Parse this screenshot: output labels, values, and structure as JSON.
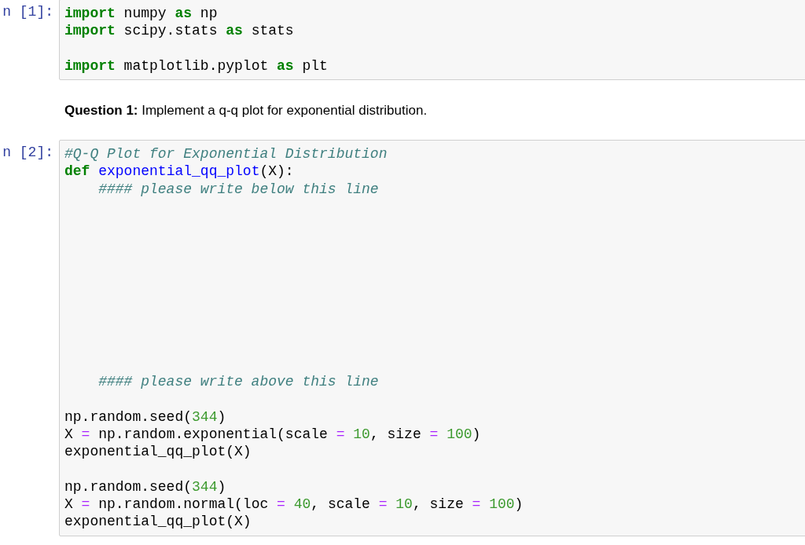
{
  "cells": [
    {
      "kind": "code",
      "prompt": "n [1]:",
      "lines": [
        {
          "kind": "code",
          "indented": false,
          "tokens": [
            {
              "kind": "keyword",
              "text": "import"
            },
            {
              "kind": "plain",
              "text": " numpy "
            },
            {
              "kind": "keyword",
              "text": "as"
            },
            {
              "kind": "plain",
              "text": " np"
            }
          ]
        },
        {
          "kind": "code",
          "indented": false,
          "tokens": [
            {
              "kind": "keyword",
              "text": "import"
            },
            {
              "kind": "plain",
              "text": " scipy.stats "
            },
            {
              "kind": "keyword",
              "text": "as"
            },
            {
              "kind": "plain",
              "text": " stats"
            }
          ]
        },
        {
          "kind": "blank"
        },
        {
          "kind": "code",
          "indented": false,
          "tokens": [
            {
              "kind": "keyword",
              "text": "import"
            },
            {
              "kind": "plain",
              "text": " matplotlib.pyplot "
            },
            {
              "kind": "keyword",
              "text": "as"
            },
            {
              "kind": "plain",
              "text": " plt"
            }
          ]
        }
      ]
    },
    {
      "kind": "markdown",
      "text": "**Question 1:** Implement a q-q plot for exponential distribution."
    },
    {
      "kind": "code",
      "prompt": "n [2]:",
      "lines": [
        {
          "kind": "code",
          "indented": false,
          "tokens": [
            {
              "kind": "comment",
              "text": "#Q-Q Plot for Exponential Distribution"
            }
          ]
        },
        {
          "kind": "code",
          "indented": false,
          "tokens": [
            {
              "kind": "keyword",
              "text": "def "
            },
            {
              "kind": "function",
              "text": "exponential_qq_plot"
            },
            {
              "kind": "plain",
              "text": "(X):"
            }
          ]
        },
        {
          "kind": "code",
          "indented": true,
          "tokens": [
            {
              "kind": "comment",
              "text": "#### please write below this line"
            }
          ]
        },
        {
          "kind": "blank"
        },
        {
          "kind": "blank"
        },
        {
          "kind": "blank"
        },
        {
          "kind": "blank"
        },
        {
          "kind": "blank"
        },
        {
          "kind": "blank"
        },
        {
          "kind": "blank"
        },
        {
          "kind": "blank"
        },
        {
          "kind": "blank"
        },
        {
          "kind": "blank"
        },
        {
          "kind": "code",
          "indented": true,
          "tokens": [
            {
              "kind": "comment",
              "text": "#### please write above this line"
            }
          ]
        },
        {
          "kind": "blank"
        },
        {
          "kind": "code",
          "indented": false,
          "tokens": [
            {
              "kind": "plain",
              "text": "np.random.seed("
            },
            {
              "kind": "number",
              "text": "344"
            },
            {
              "kind": "plain",
              "text": ")"
            }
          ]
        },
        {
          "kind": "code",
          "indented": false,
          "tokens": [
            {
              "kind": "plain",
              "text": "X "
            },
            {
              "kind": "operator",
              "text": "= "
            },
            {
              "kind": "plain",
              "text": "np.random.exponential(scale "
            },
            {
              "kind": "operator",
              "text": "= "
            },
            {
              "kind": "number",
              "text": "10"
            },
            {
              "kind": "plain",
              "text": ", size "
            },
            {
              "kind": "operator",
              "text": "= "
            },
            {
              "kind": "number",
              "text": "100"
            },
            {
              "kind": "plain",
              "text": ")"
            }
          ]
        },
        {
          "kind": "code",
          "indented": false,
          "tokens": [
            {
              "kind": "plain",
              "text": "exponential_qq_plot(X)"
            }
          ]
        },
        {
          "kind": "blank"
        },
        {
          "kind": "code",
          "indented": false,
          "tokens": [
            {
              "kind": "plain",
              "text": "np.random.seed("
            },
            {
              "kind": "number",
              "text": "344"
            },
            {
              "kind": "plain",
              "text": ")"
            }
          ]
        },
        {
          "kind": "code",
          "indented": false,
          "tokens": [
            {
              "kind": "plain",
              "text": "X "
            },
            {
              "kind": "operator",
              "text": "= "
            },
            {
              "kind": "plain",
              "text": "np.random.normal(loc "
            },
            {
              "kind": "operator",
              "text": "= "
            },
            {
              "kind": "number",
              "text": "40"
            },
            {
              "kind": "plain",
              "text": ", scale "
            },
            {
              "kind": "operator",
              "text": "= "
            },
            {
              "kind": "number",
              "text": "10"
            },
            {
              "kind": "plain",
              "text": ", size "
            },
            {
              "kind": "operator",
              "text": "= "
            },
            {
              "kind": "number",
              "text": "100"
            },
            {
              "kind": "plain",
              "text": ")"
            }
          ]
        },
        {
          "kind": "code",
          "indented": false,
          "tokens": [
            {
              "kind": "plain",
              "text": "exponential_qq_plot(X)"
            }
          ]
        }
      ]
    }
  ]
}
